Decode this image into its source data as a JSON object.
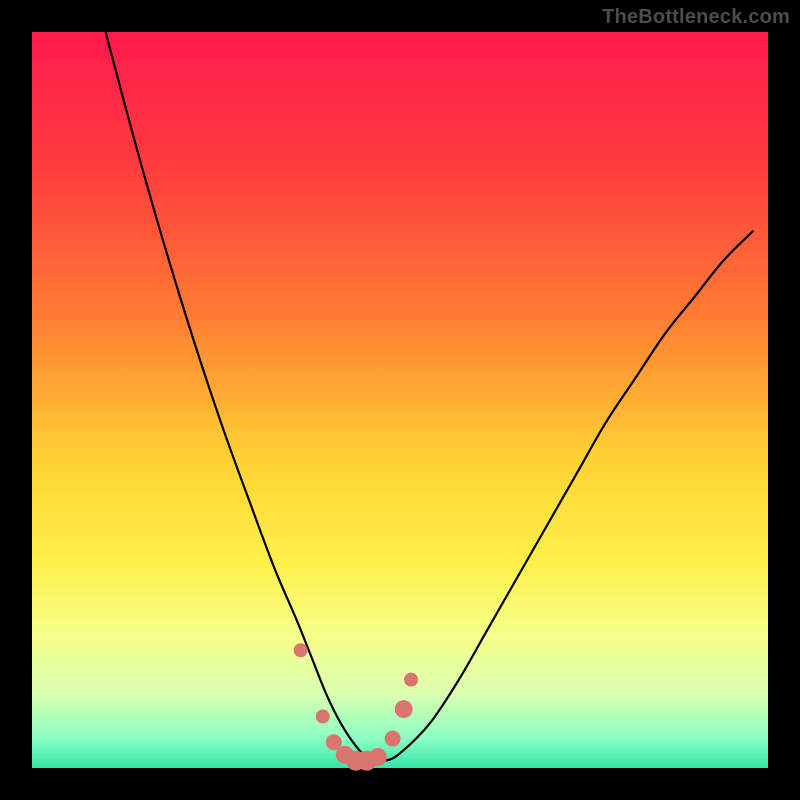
{
  "watermark": "TheBottleneck.com",
  "colors": {
    "black": "#000000",
    "gradient_stops": [
      {
        "offset": 0.0,
        "color": "#ff1a4d"
      },
      {
        "offset": 0.18,
        "color": "#ff3b3e"
      },
      {
        "offset": 0.38,
        "color": "#ff7a33"
      },
      {
        "offset": 0.58,
        "color": "#ffd233"
      },
      {
        "offset": 0.72,
        "color": "#fff04a"
      },
      {
        "offset": 0.82,
        "color": "#f6ff8a"
      },
      {
        "offset": 0.9,
        "color": "#d8ffb0"
      },
      {
        "offset": 0.96,
        "color": "#8cffc4"
      },
      {
        "offset": 1.0,
        "color": "#33e6a6"
      }
    ],
    "curve": "#000000",
    "marker_fill": "#d9746e",
    "marker_stroke": "#b85a55"
  },
  "chart_data": {
    "type": "line",
    "title": "",
    "xlabel": "",
    "ylabel": "",
    "xlim": [
      0,
      100
    ],
    "ylim": [
      0,
      100
    ],
    "series": [
      {
        "name": "bottleneck-curve",
        "x": [
          10,
          14,
          18,
          22,
          26,
          30,
          33,
          36,
          38,
          40,
          42,
          44,
          46,
          48,
          50,
          54,
          58,
          62,
          66,
          70,
          74,
          78,
          82,
          86,
          90,
          94,
          98
        ],
        "y": [
          100,
          85,
          71,
          58,
          46,
          35,
          27,
          20,
          15,
          10,
          6,
          3,
          1,
          1,
          2,
          6,
          12,
          19,
          26,
          33,
          40,
          47,
          53,
          59,
          64,
          69,
          73
        ]
      }
    ],
    "markers": {
      "name": "highlight-points",
      "x": [
        36.5,
        39.5,
        41.0,
        42.5,
        44.0,
        45.5,
        47.0,
        49.0,
        50.5,
        51.5
      ],
      "y": [
        16.0,
        7.0,
        3.5,
        1.8,
        1.0,
        1.0,
        1.5,
        4.0,
        8.0,
        12.0
      ],
      "r": [
        7,
        7,
        8,
        9,
        10,
        10,
        9,
        8,
        9,
        7
      ]
    }
  }
}
